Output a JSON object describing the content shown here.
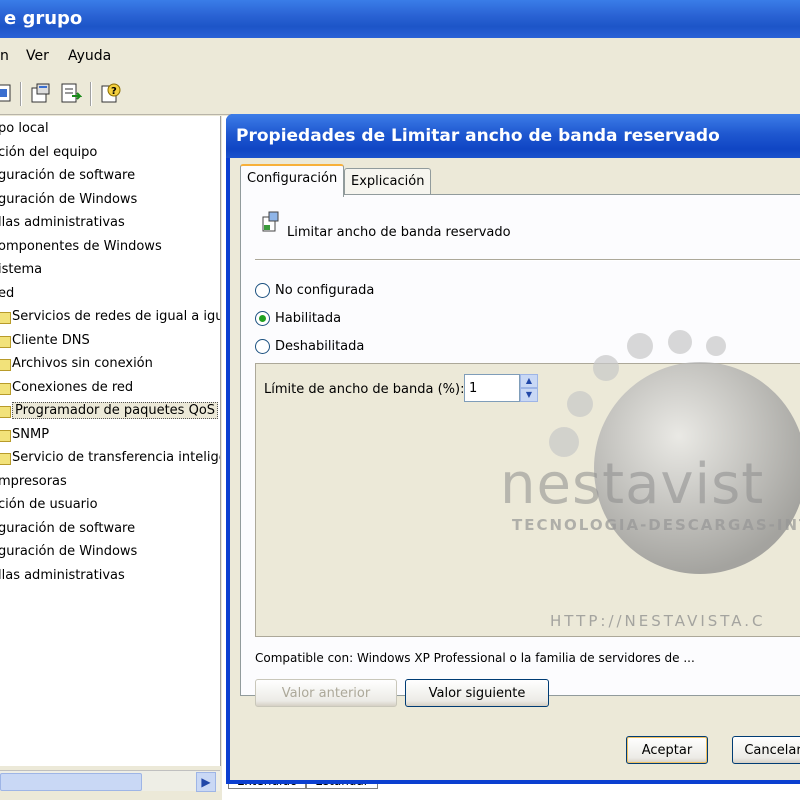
{
  "window": {
    "title": "e grupo"
  },
  "menu": {
    "items": [
      "n",
      "Ver",
      "Ayuda"
    ]
  },
  "tree": {
    "items": [
      {
        "label": "po local",
        "indent": 0,
        "folder": false
      },
      {
        "label": "ción del equipo",
        "indent": 0,
        "folder": false
      },
      {
        "label": "guración de software",
        "indent": 0,
        "folder": false
      },
      {
        "label": "guración de Windows",
        "indent": 0,
        "folder": false
      },
      {
        "label": "llas administrativas",
        "indent": 0,
        "folder": false
      },
      {
        "label": "omponentes de Windows",
        "indent": 0,
        "folder": false
      },
      {
        "label": "istema",
        "indent": 0,
        "folder": false
      },
      {
        "label": "ed",
        "indent": 0,
        "folder": false
      },
      {
        "label": "Servicios de redes de igual a igua",
        "indent": 1,
        "folder": true
      },
      {
        "label": "Cliente DNS",
        "indent": 1,
        "folder": true
      },
      {
        "label": "Archivos sin conexión",
        "indent": 1,
        "folder": true
      },
      {
        "label": "Conexiones de red",
        "indent": 1,
        "folder": true
      },
      {
        "label": "Programador de paquetes QoS",
        "indent": 1,
        "folder": true,
        "selected": true
      },
      {
        "label": "SNMP",
        "indent": 1,
        "folder": true
      },
      {
        "label": "Servicio de transferencia inteliger",
        "indent": 1,
        "folder": true
      },
      {
        "label": "mpresoras",
        "indent": 0,
        "folder": false
      },
      {
        "label": "ción de usuario",
        "indent": 0,
        "folder": false
      },
      {
        "label": "guración de software",
        "indent": 0,
        "folder": false
      },
      {
        "label": "guración de Windows",
        "indent": 0,
        "folder": false
      },
      {
        "label": "llas administrativas",
        "indent": 0,
        "folder": false
      }
    ]
  },
  "bottom_tabs": [
    "Extendido",
    "Estándar"
  ],
  "dialog": {
    "title": "Propiedades de Limitar ancho de banda reservado",
    "tabs": [
      "Configuración",
      "Explicación"
    ],
    "active_tab": "Configuración",
    "policy_name": "Limitar ancho de banda reservado",
    "radios": [
      {
        "label": "No configurada",
        "checked": false
      },
      {
        "label": "Habilitada",
        "checked": true
      },
      {
        "label": "Deshabilitada",
        "checked": false
      }
    ],
    "option_label": "Límite de ancho de banda (%):",
    "option_value": "1",
    "compat": "Compatible con: Windows XP Professional o la familia de servidores de ...",
    "prev_button": "Valor anterior",
    "next_button": "Valor siguiente",
    "ok_button": "Aceptar",
    "cancel_button": "Cancelar"
  },
  "watermark": {
    "brand": "nestavist",
    "tagline": "TECNOLOGIA-DESCARGAS-INTE",
    "url": "HTTP://NESTAVISTA.C"
  }
}
